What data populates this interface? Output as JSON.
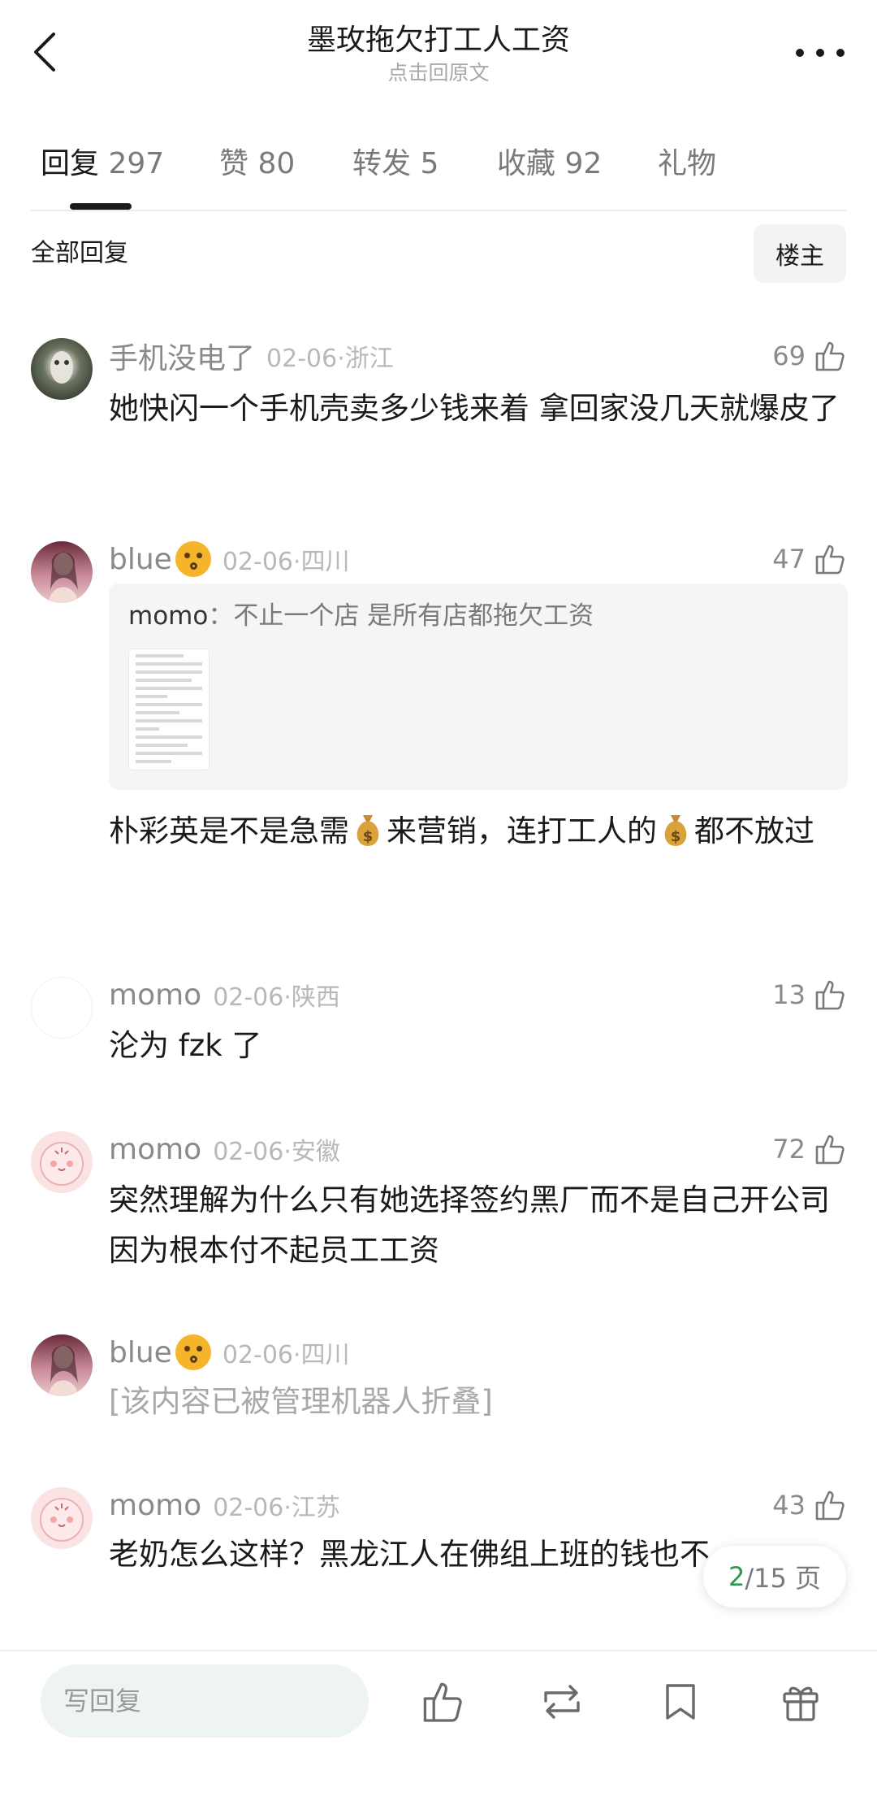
{
  "header": {
    "title": "墨玫拖欠打工人工资",
    "subtitle": "点击回原文"
  },
  "tabs": [
    {
      "label": "回复",
      "count": "297",
      "active": true
    },
    {
      "label": "赞",
      "count": "80"
    },
    {
      "label": "转发",
      "count": "5"
    },
    {
      "label": "收藏",
      "count": "92"
    },
    {
      "label": "礼物",
      "count": ""
    }
  ],
  "filter": {
    "label": "全部回复",
    "owner_button": "楼主"
  },
  "comments": [
    {
      "username": "手机没电了",
      "date": "02-06",
      "location": "浙江",
      "likes": "69",
      "content": "她快闪一个手机壳卖多少钱来着  拿回家没几天就爆皮了"
    },
    {
      "username": "blue",
      "date": "02-06",
      "location": "四川",
      "likes": "47",
      "quote": {
        "user": "momo",
        "separator": "：",
        "text": "不止一个店 是所有店都拖欠工资"
      },
      "content_parts": [
        "朴彩英是不是急需",
        "来营销，连打工人的",
        "都不放过"
      ]
    },
    {
      "username": "momo",
      "date": "02-06",
      "location": "陕西",
      "likes": "13",
      "content": "沦为 fzk 了"
    },
    {
      "username": "momo",
      "date": "02-06",
      "location": "安徽",
      "likes": "72",
      "content": "突然理解为什么只有她选择签约黑厂而不是自己开公司 因为根本付不起员工工资"
    },
    {
      "username": "blue",
      "date": "02-06",
      "location": "四川",
      "likes": "",
      "content": "[该内容已被管理机器人折叠]"
    },
    {
      "username": "momo",
      "date": "02-06",
      "location": "江苏",
      "likes": "43",
      "content": "老奶怎么这样？黑龙江人在佛组上班的钱也不"
    }
  ],
  "pagination": {
    "current": "2",
    "total": "/15 页"
  },
  "bottom_bar": {
    "reply_placeholder": "写回复"
  },
  "icons": [
    "back-arrow-icon",
    "more-dots-icon",
    "thumbs-up-icon",
    "money-bag-icon",
    "repost-icon",
    "bookmark-icon",
    "gift-icon"
  ],
  "colors": {
    "accent_green": "#2e9a4e",
    "muted_text": "#8a8a8a",
    "input_bg": "#eef4ef"
  }
}
